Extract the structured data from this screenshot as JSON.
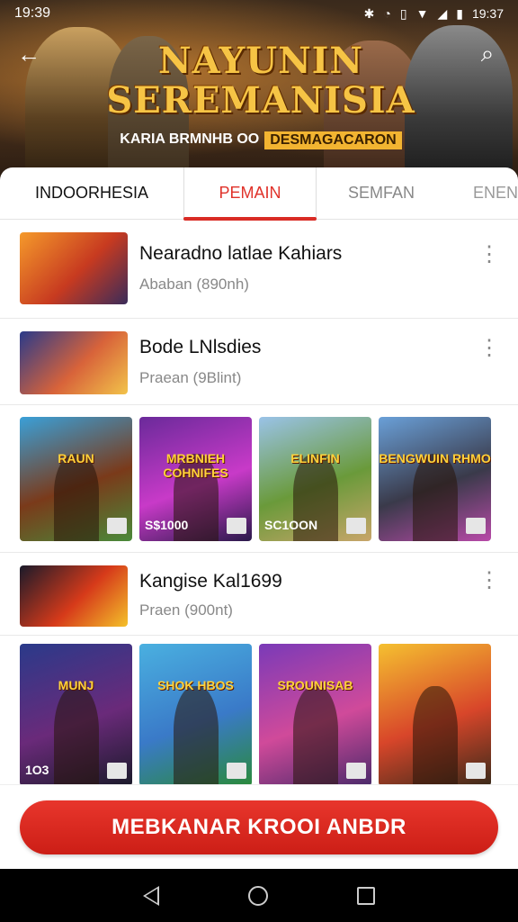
{
  "status_bar": {
    "time_left": "19:39",
    "time_right": "19:37",
    "icons": [
      "bluetooth-icon",
      "alarm-icon",
      "vibrate-icon",
      "wifi-icon",
      "signal-icon",
      "battery-icon"
    ]
  },
  "hero": {
    "title": "NAYUNIN SEREMANISIA",
    "subtitle": "KARIA BRMNHB OO",
    "subtitle_tag": "DESMAGACARON"
  },
  "tabs": [
    "INDOORHESIA",
    "PEMAIN",
    "SEMFAN",
    "ENEN"
  ],
  "active_tab": "PEMAIN",
  "list": [
    {
      "title": "Nearadno latlae Kahiars",
      "subtitle": "Ababan (890nh)",
      "thumb_colors": [
        "#f59a2b",
        "#c73a20",
        "#3a2c5a"
      ]
    },
    {
      "title": "Bode LNlsdies",
      "subtitle": "Praean (9Blint)",
      "thumb_colors": [
        "#2a3a8a",
        "#d8633a",
        "#f2c34a"
      ]
    },
    {
      "title": "Kangise Kal1699",
      "subtitle": "Praen (900nt)",
      "thumb_colors": [
        "#1a1a2a",
        "#d63a1a",
        "#f4c12a"
      ]
    }
  ],
  "grid_1": [
    {
      "label": "RAUN",
      "price": "",
      "colors": [
        "#3aa0d8",
        "#7a3a1a",
        "#4a8a3a"
      ]
    },
    {
      "label": "MRBNIEH COHNIFES",
      "price": "S$1000",
      "colors": [
        "#6a2a9a",
        "#c83ac8",
        "#2a1a4a"
      ]
    },
    {
      "label": "ELINFIN",
      "price": "SC1OON",
      "colors": [
        "#9ac3e8",
        "#6a9a3a",
        "#c8a56a"
      ]
    },
    {
      "label": "BENGWUIN RHMO",
      "price": "",
      "colors": [
        "#6aa0d8",
        "#3a3a4a",
        "#b84aa8"
      ]
    }
  ],
  "grid_2": [
    {
      "label": "MUNJ",
      "price": "1O3",
      "colors": [
        "#2a3a8a",
        "#6a2a7a",
        "#1a1a2a"
      ]
    },
    {
      "label": "SHOK HBOS",
      "price": "",
      "colors": [
        "#4ab0e0",
        "#3a7ac8",
        "#2a8a3a"
      ]
    },
    {
      "label": "SROUNISAB",
      "price": "",
      "colors": [
        "#7a3ab8",
        "#d04a9a",
        "#4a2a6a"
      ]
    },
    {
      "label": "",
      "price": "",
      "colors": [
        "#f5c030",
        "#d8462a",
        "#3a2a1a"
      ]
    }
  ],
  "cta": {
    "label": "MEBKANAR KROOI ANBDR"
  },
  "colors": {
    "accent": "#d92b25",
    "text": "#111111",
    "muted": "#888888"
  }
}
